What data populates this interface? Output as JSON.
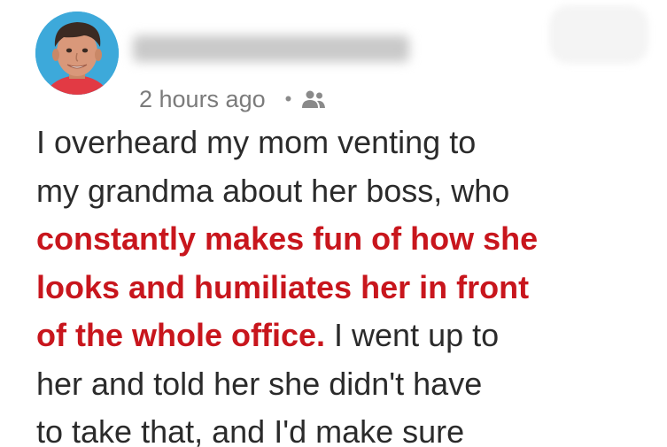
{
  "post": {
    "author_avatar": "avatar-photo",
    "author_name_blurred": "Yourname",
    "timestamp": "2 hours ago",
    "separator": "•",
    "audience_icon": "people-icon",
    "colors": {
      "text": "#2b2b2b",
      "highlight": "#c8161d",
      "meta": "#7b7b7b"
    },
    "body": {
      "l1": "I overheard my mom venting to",
      "l2": "my grandma about her boss, who",
      "l3": "constantly makes fun of how she",
      "l4": "looks and humiliates her in front",
      "l5_highlight": "of the whole office.",
      "l5_rest": " I went up to",
      "l6": "her and told her she didn't have",
      "l7": "to take that, and I'd make sure"
    }
  }
}
